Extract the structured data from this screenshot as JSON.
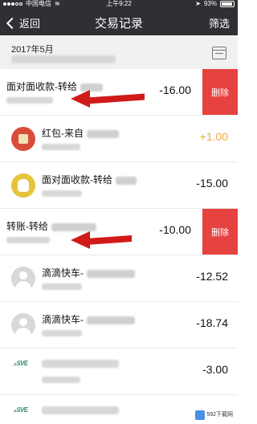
{
  "status_bar": {
    "carrier": "中国电信",
    "time": "上午9:22",
    "battery": "93%"
  },
  "nav": {
    "back_label": "返回",
    "title": "交易记录",
    "filter_label": "筛选"
  },
  "month_header": {
    "month": "2017年5月"
  },
  "rows": [
    {
      "title": "面对面收款-转给",
      "amount": "-16.00",
      "icon": "none",
      "delete_label": "删除",
      "swiped": true
    },
    {
      "title": "红包-来自",
      "amount": "+1.00",
      "icon": "red-envelope-icon"
    },
    {
      "title": "面对面收款-转给",
      "amount": "-15.00",
      "icon": "money-bag-icon"
    },
    {
      "title": "转账-转给",
      "amount": "-10.00",
      "icon": "none",
      "delete_label": "删除",
      "swiped": true
    },
    {
      "title": "滴滴快车-",
      "amount": "-12.52",
      "icon": "avatar-icon"
    },
    {
      "title": "滴滴快车-",
      "amount": "-18.74",
      "icon": "avatar-icon"
    },
    {
      "title": "",
      "amount": "-3.00",
      "icon": "merchant-logo-icon"
    },
    {
      "title": "",
      "amount": "",
      "icon": "merchant-logo-icon"
    }
  ],
  "watermark": {
    "text": "592下载网"
  },
  "colors": {
    "nav_bg": "#2e3033",
    "delete_bg": "#e64340",
    "positive_amount": "#f1a93f",
    "arrow": "#d11a1a"
  }
}
